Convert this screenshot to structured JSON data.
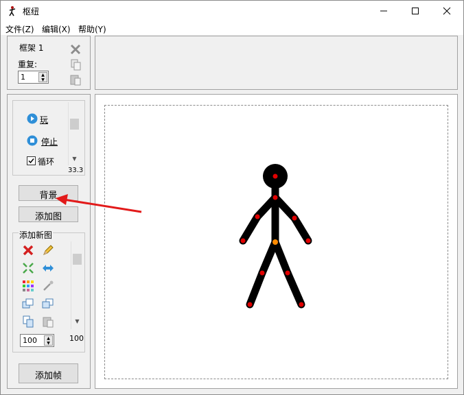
{
  "window": {
    "title": "枢纽"
  },
  "menu": {
    "file": "文件(Z)",
    "edit": "编辑(X)",
    "help": "帮助(Y)"
  },
  "frame_panel": {
    "frame_label": "框架 1",
    "repeat_label": "重复:",
    "repeat_value": "1"
  },
  "playback": {
    "play": "玩",
    "stop": "停止",
    "loop": "循环",
    "loop_checked": true,
    "speed_value": "33.3"
  },
  "buttons": {
    "background": "背景",
    "add_image": "添加图",
    "add_frame": "添加帧"
  },
  "new_figure": {
    "label": "添加新图",
    "size_value": "100",
    "scroll_value": "100"
  },
  "colors": {
    "accent_arrow": "#e21a1a",
    "stick_figure": "#000000",
    "joint_red": "#e00000",
    "joint_orange": "#ff8a00"
  }
}
